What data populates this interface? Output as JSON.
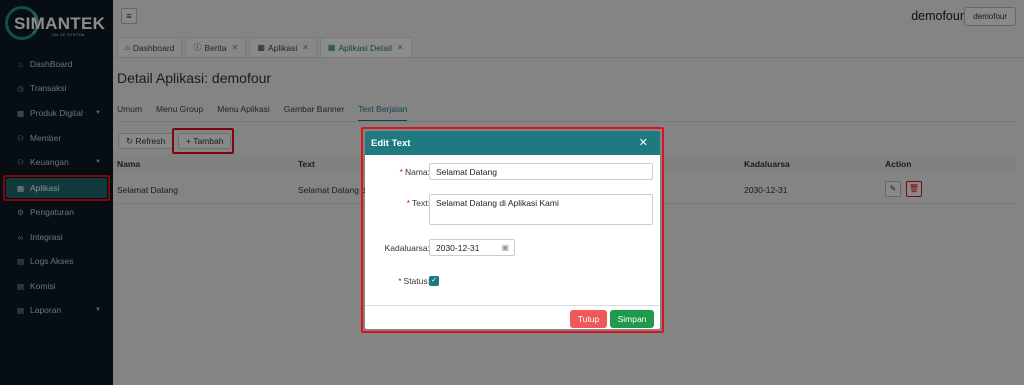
{
  "app": {
    "logo": "SIMANTEK",
    "logo_sub": "VALUE SYSTEM"
  },
  "sidebar": {
    "items": [
      {
        "label": "DashBoard",
        "icon": "home-icon"
      },
      {
        "label": "Transaksi",
        "icon": "clock-icon"
      },
      {
        "label": "Produk Digital",
        "icon": "grid-icon",
        "expandable": true
      },
      {
        "label": "Member",
        "icon": "users-icon"
      },
      {
        "label": "Keuangan",
        "icon": "users-icon",
        "expandable": true
      },
      {
        "label": "Aplikasi",
        "icon": "grid-icon",
        "active": true
      },
      {
        "label": "Pengaturan",
        "icon": "gear-icon"
      },
      {
        "label": "Integrasi",
        "icon": "link-icon"
      },
      {
        "label": "Logs Akses",
        "icon": "file-icon"
      },
      {
        "label": "Komisi",
        "icon": "file-icon"
      },
      {
        "label": "Laporan",
        "icon": "file-icon",
        "expandable": true
      }
    ]
  },
  "header": {
    "username": "demofour",
    "user_button": "demofour"
  },
  "tabs": [
    {
      "label": "Dashboard",
      "icon": "home-icon"
    },
    {
      "label": "Berita",
      "icon": "info-icon",
      "closable": true
    },
    {
      "label": "Aplikasi",
      "icon": "grid-icon",
      "closable": true
    },
    {
      "label": "Aplikasi Detail",
      "icon": "grid-icon",
      "closable": true,
      "active": true
    }
  ],
  "page": {
    "title": "Detail Aplikasi: demofour"
  },
  "subtabs": [
    "Umum",
    "Menu Group",
    "Menu Aplikasi",
    "Gambar Banner",
    "Text Berjalan"
  ],
  "toolbar": {
    "refresh": "Refresh",
    "add": "Tambah"
  },
  "table": {
    "headers": [
      "Nama",
      "Text",
      "",
      "Kadaluarsa",
      "Action"
    ],
    "rows": [
      {
        "nama": "Selamat Datang",
        "text": "Selamat Datang di",
        "kadaluarsa": "2030-12-31"
      }
    ]
  },
  "modal": {
    "title": "Edit Text",
    "labels": {
      "nama": "Nama:",
      "text": "Text:",
      "kadaluarsa": "Kadaluarsa:",
      "status": "Status:"
    },
    "values": {
      "nama": "Selamat Datang",
      "text": "Selamat Datang di Aplikasi Kami",
      "kadaluarsa": "2030-12-31",
      "status": true
    },
    "buttons": {
      "close": "Tutup",
      "save": "Simpan"
    }
  },
  "colors": {
    "primary": "#1e7a80",
    "sidebar_bg": "#0c1b26",
    "danger": "#ee5a5a",
    "success": "#1f9a4a",
    "highlight": "#e0101c"
  }
}
